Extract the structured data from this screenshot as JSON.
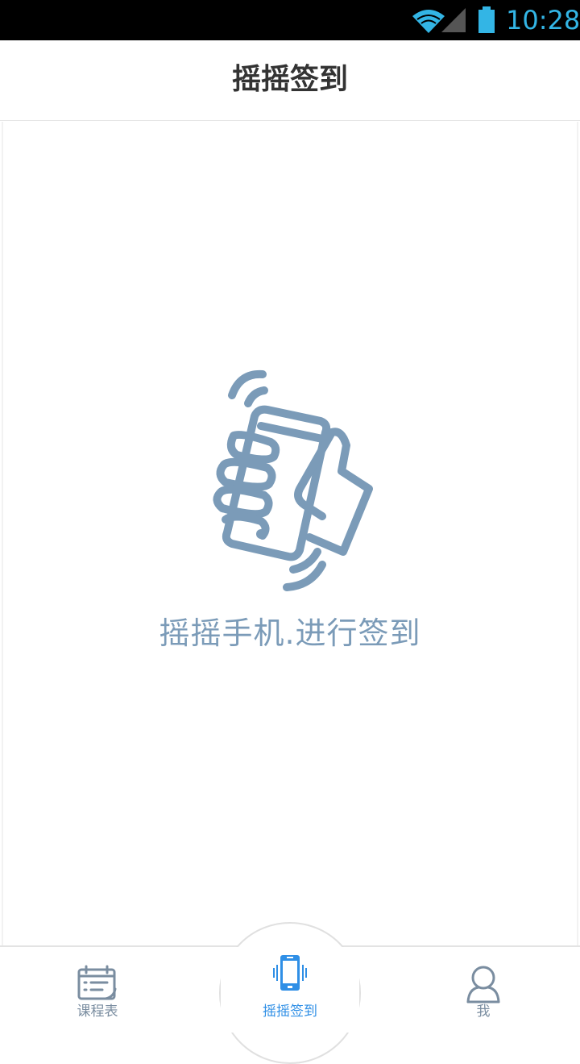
{
  "status_bar": {
    "time": "10:28",
    "icons": [
      "wifi-icon",
      "signal-icon",
      "battery-icon"
    ],
    "accent_color": "#33b5e5"
  },
  "header": {
    "title": "摇摇签到"
  },
  "main": {
    "illustration": "hand-shaking-phone-icon",
    "prompt": "摇摇手机.进行签到",
    "prompt_color": "#7b9bb8"
  },
  "bottom_nav": {
    "items": [
      {
        "label": "课程表",
        "icon": "calendar-icon",
        "active": false
      },
      {
        "label": "摇摇签到",
        "icon": "shake-phone-icon",
        "active": true
      },
      {
        "label": "我",
        "icon": "user-icon",
        "active": false
      }
    ],
    "active_color": "#2f8fe6",
    "inactive_color": "#7a8da0"
  }
}
